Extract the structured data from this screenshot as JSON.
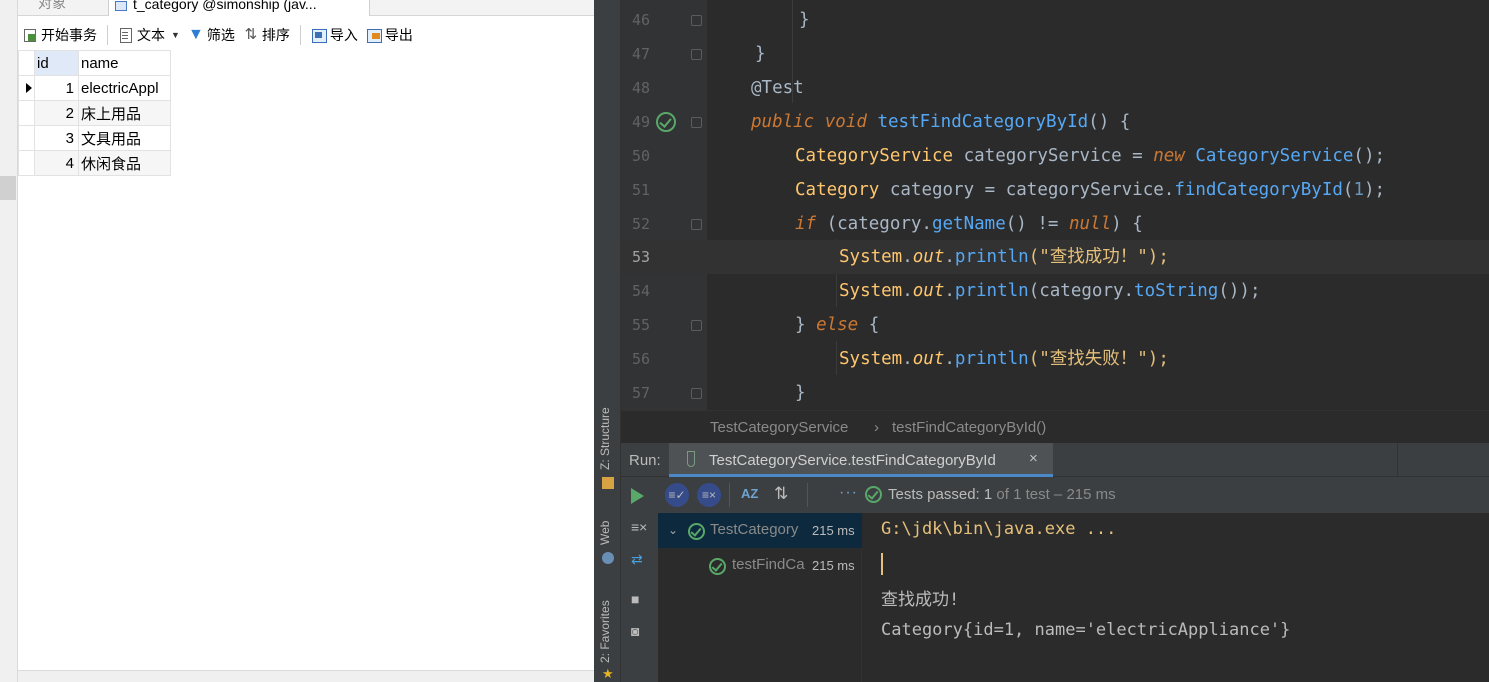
{
  "navicat": {
    "tabs": {
      "objects": "对象",
      "table": "t_category @simonship (jav..."
    },
    "toolbar": {
      "begin_tx": "开始事务",
      "text": "文本",
      "filter": "筛选",
      "sort": "排序",
      "import": "导入",
      "export": "导出"
    },
    "grid": {
      "columns": [
        "id",
        "name"
      ],
      "rows": [
        {
          "id": "1",
          "name": "electricAppl"
        },
        {
          "id": "2",
          "name": "床上用品"
        },
        {
          "id": "3",
          "name": "文具用品"
        },
        {
          "id": "4",
          "name": "休闲食品"
        }
      ]
    }
  },
  "ide": {
    "side_tools": {
      "structure": "Z: Structure",
      "web": "Web",
      "favorites": "2: Favorites"
    },
    "editor": {
      "line_numbers": [
        "46",
        "47",
        "48",
        "49",
        "50",
        "51",
        "52",
        "53",
        "54",
        "55",
        "56",
        "57"
      ],
      "current_line": "53",
      "code": {
        "l46": "}",
        "l47": "}",
        "l48_ann": "@Test",
        "l49_kw1": "public",
        "l49_kw2": "void",
        "l49_name": "testFindCategoryById",
        "l49_rest": "() {",
        "l50_type": "CategoryService",
        "l50_var": " categoryService = ",
        "l50_new": "new",
        "l50_cls": " CategoryService",
        "l50_end": "();",
        "l51_type": "Category",
        "l51_var": " category = categoryService.",
        "l51_call": "findCategoryById",
        "l51_p1": "(",
        "l51_num": "1",
        "l51_end": ");",
        "l52_if": "if",
        "l52_a": " (category.",
        "l52_call": "getName",
        "l52_b": "() != ",
        "l52_null": "null",
        "l52_c": ") {",
        "l53_sys": "System",
        "l53_out": "out",
        "l53_call": "println",
        "l53_str": "(\"查找成功！\");",
        "l54_sys": "System",
        "l54_out": "out",
        "l54_call": "println",
        "l54_a": "(category.",
        "l54_call2": "toString",
        "l54_b": "());",
        "l55_a": "} ",
        "l55_else": "else",
        "l55_b": " {",
        "l56_sys": "System",
        "l56_out": "out",
        "l56_call": "println",
        "l56_str": "(\"查找失败！\");",
        "l57": "}"
      }
    },
    "breadcrumb": {
      "class": "TestCategoryService",
      "sep": "›",
      "method": "testFindCategoryById()"
    },
    "run": {
      "label": "Run:",
      "tab": "TestCategoryService.testFindCategoryById",
      "close": "×",
      "status_prefix": "Tests passed: ",
      "status_count": "1",
      "status_rest": " of 1 test – 215 ms",
      "tree": [
        {
          "name": "TestCategory",
          "time": "215 ms"
        },
        {
          "name": "testFindCa",
          "time": "215 ms"
        }
      ],
      "console": [
        "G:\\jdk\\bin\\java.exe ...",
        "查找成功!",
        "Category{id=1, name='electricAppliance'}"
      ]
    }
  }
}
